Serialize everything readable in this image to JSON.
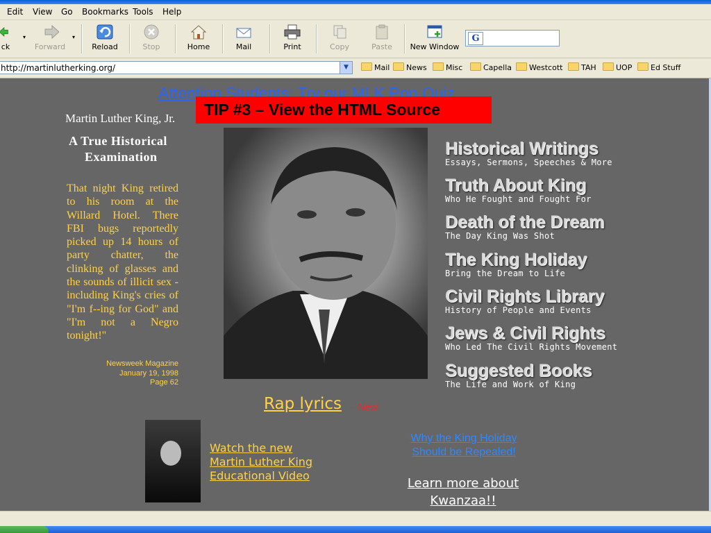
{
  "menu": [
    "Edit",
    "View",
    "Go",
    "Bookmarks",
    "Tools",
    "Help"
  ],
  "toolbar": {
    "back": "ck",
    "forward": "Forward",
    "reload": "Reload",
    "stop": "Stop",
    "home": "Home",
    "mail": "Mail",
    "print": "Print",
    "copy": "Copy",
    "paste": "Paste",
    "new_window": "New Window"
  },
  "address": "http://martinlutherking.org/",
  "bookmarks": [
    "Mail",
    "News",
    "Misc",
    "Capella",
    "Westcott",
    "TAH",
    "UOP",
    "Ed Stuff"
  ],
  "page": {
    "attention": "Attention Students: Try our MLK Pop Quiz",
    "tip": "TIP #3 – View the HTML Source",
    "name": "Martin Luther King, Jr.",
    "sub1": "A True Historical",
    "sub2": "Examination",
    "quote": "That night King retired to his room at the Willard Hotel. There FBI bugs reportedly picked up 14 hours of party chatter, the clinking of glasses and the sounds of illicit sex - including King's cries of \"I'm f--ing for God\" and \"I'm not a Negro tonight!\"",
    "cite1": "Newsweek Magazine",
    "cite2": "January 19, 1998",
    "cite3": "Page 62",
    "nav": [
      {
        "h": "Historical Writings",
        "s": "Essays, Sermons, Speeches & More"
      },
      {
        "h": "Truth About King",
        "s": "Who He Fought and Fought For"
      },
      {
        "h": "Death of the Dream",
        "s": "The Day King Was Shot"
      },
      {
        "h": "The King Holiday",
        "s": "Bring the Dream to Life"
      },
      {
        "h": "Civil Rights Library",
        "s": "History of People and Events"
      },
      {
        "h": "Jews & Civil Rights",
        "s": "Who Led The Civil Rights Movement"
      },
      {
        "h": "Suggested Books",
        "s": "The Life and Work of King"
      }
    ],
    "rap": "Rap lyrics",
    "new": "- New!",
    "video1": "Watch the new",
    "video2": "Martin Luther King",
    "video3": "Educational Video",
    "why1": "Why the King Holiday",
    "why2": "Should be Repealed!",
    "learn1": "Learn more about",
    "learn2": "Kwanzaa!!"
  },
  "colors": {
    "page_bg": "#666666",
    "accent_yellow": "#ffd24a",
    "link_blue": "#2e64f0",
    "tip_red": "#ff0000"
  }
}
